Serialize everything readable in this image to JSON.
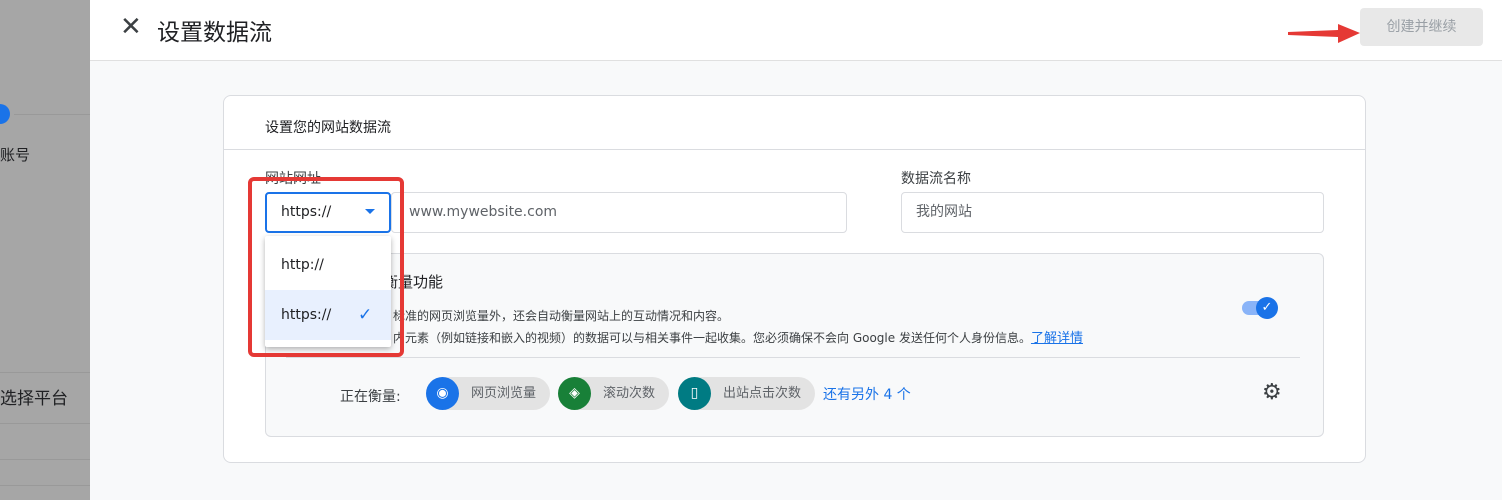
{
  "sidebar": {
    "item_account": "账号",
    "item_platform": "选择平台"
  },
  "header": {
    "title": "设置数据流",
    "primary_button": "创建并继续"
  },
  "card": {
    "title": "设置您的网站数据流",
    "url_label": "网站网址",
    "protocol_selected": "https://",
    "url_placeholder": "www.mywebsite.com",
    "name_label": "数据流名称",
    "name_placeholder": "我的网站",
    "dropdown_options": [
      {
        "label": "http://",
        "selected": false
      },
      {
        "label": "https://",
        "selected": true
      }
    ],
    "enhanced": {
      "title_fragment": "衡量功能",
      "desc_line1": "标准的网页浏览量外，还会自动衡量网站上的互动情况和内容。",
      "desc_line2": "内元素（例如链接和嵌入的视频）的数据可以与相关事件一起收集。您必须确保不会向 Google 发送任何个人身份信息。",
      "learn_more": "了解详情",
      "toggle_on": true,
      "measuring_label": "正在衡量:",
      "chips": [
        {
          "label": "网页浏览量",
          "icon": "eye-icon",
          "color": "#1a73e8"
        },
        {
          "label": "滚动次数",
          "icon": "scroll-icon",
          "color": "#188038"
        },
        {
          "label": "出站点击次数",
          "icon": "mouse-icon",
          "color": "#007b83"
        }
      ],
      "more": "还有另外 4 个"
    }
  },
  "colors": {
    "accent": "#1a73e8",
    "annotation": "#e53935"
  }
}
